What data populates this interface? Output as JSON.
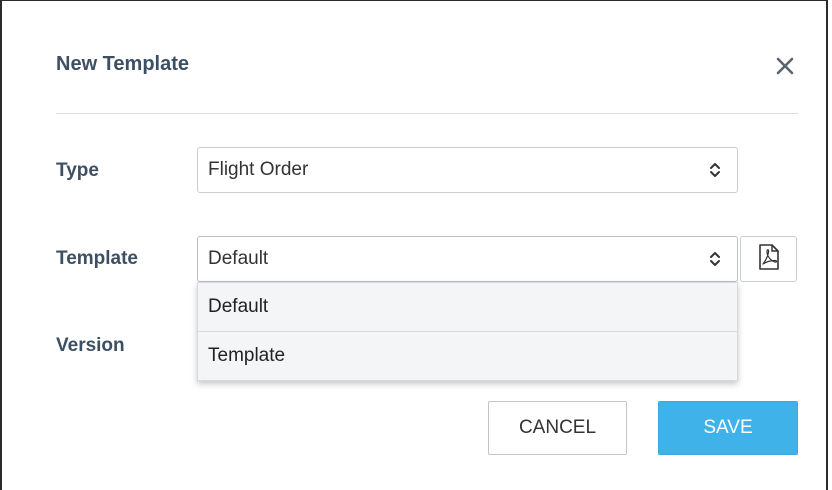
{
  "dialog": {
    "title": "New Template",
    "close_icon": "close-icon"
  },
  "form": {
    "type_label": "Type",
    "type_value": "Flight Order",
    "template_label": "Template",
    "template_value": "Default",
    "version_label": "Version",
    "pdf_icon": "pdf-icon"
  },
  "dropdown": {
    "options": [
      "Default",
      "Template"
    ]
  },
  "buttons": {
    "cancel": "CANCEL",
    "save": "SAVE"
  },
  "colors": {
    "label": "#3d4f63",
    "save_bg": "#3fb2ea",
    "divider": "#dcdfe3"
  }
}
